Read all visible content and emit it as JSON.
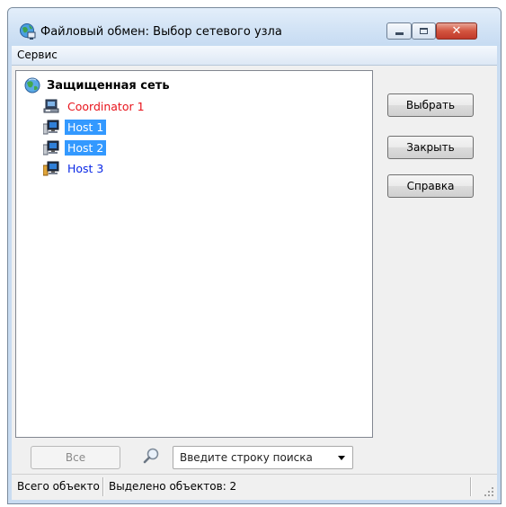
{
  "window": {
    "title": "Файловый обмен: Выбор сетевого узла",
    "controls": {
      "minimize": "",
      "maximize": "",
      "close": "✕"
    }
  },
  "menu": {
    "items": [
      {
        "label": "Сервис"
      }
    ]
  },
  "tree": {
    "root": {
      "label": "Защищенная сеть",
      "icon": "globe-network-icon"
    },
    "nodes": [
      {
        "label": "Coordinator 1",
        "icon": "coordinator-computer-icon",
        "color": "#e8141c",
        "selected": false
      },
      {
        "label": "Host 1",
        "icon": "host-computer-icon",
        "color": "#ffffff",
        "selected": true
      },
      {
        "label": "Host 2",
        "icon": "host-computer-icon",
        "color": "#ffffff",
        "selected": true
      },
      {
        "label": "Host 3",
        "icon": "host-computer-icon",
        "color": "#0a28e6",
        "selected": false
      }
    ]
  },
  "bottom": {
    "all_button": "Все",
    "search": {
      "placeholder": "Введите строку поиска"
    }
  },
  "actions": {
    "select": "Выбрать",
    "close": "Закрыть",
    "help": "Справка"
  },
  "status": {
    "total": "Всего объектов",
    "selected": "Выделено объектов: 2"
  },
  "colors": {
    "selection": "#3399ff",
    "coordinator": "#e8141c",
    "host": "#0a28e6"
  }
}
